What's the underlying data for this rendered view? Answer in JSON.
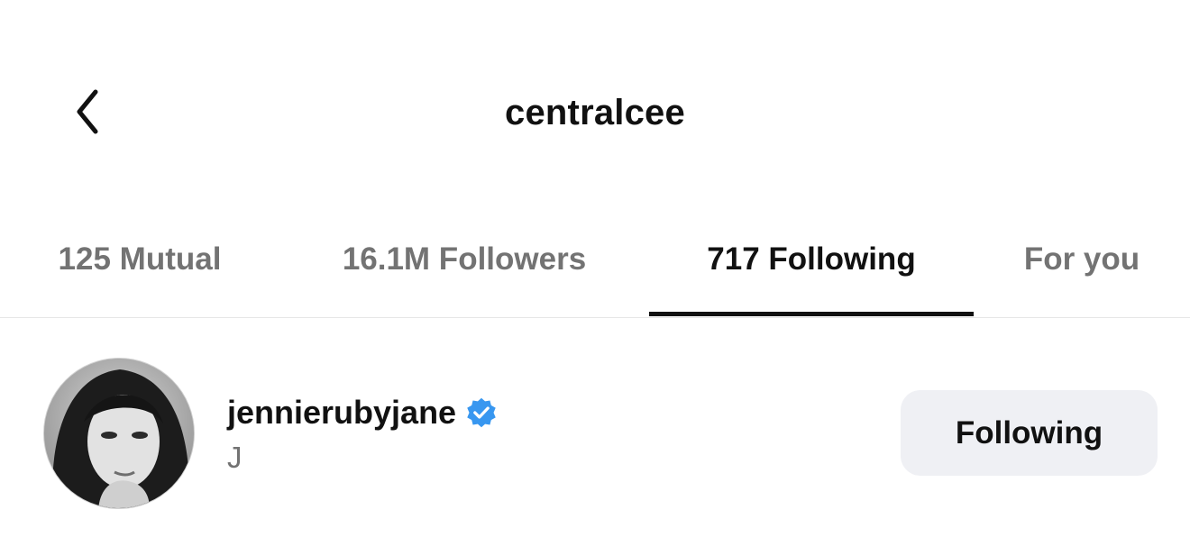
{
  "header": {
    "back_icon": "chevron-left-icon",
    "title": "centralcee"
  },
  "tabs": [
    {
      "label": "125 Mutual",
      "active": false
    },
    {
      "label": "16.1M Followers",
      "active": false
    },
    {
      "label": "717 Following",
      "active": true
    },
    {
      "label": "For you",
      "active": false
    }
  ],
  "list": {
    "items": [
      {
        "username": "jennierubyjane",
        "verified": true,
        "verified_icon": "verified-badge-icon",
        "full_name": "J",
        "button_label": "Following"
      }
    ]
  },
  "colors": {
    "accent_verified": "#3897f0",
    "inactive_text": "#737373",
    "button_bg": "#eff0f4"
  }
}
